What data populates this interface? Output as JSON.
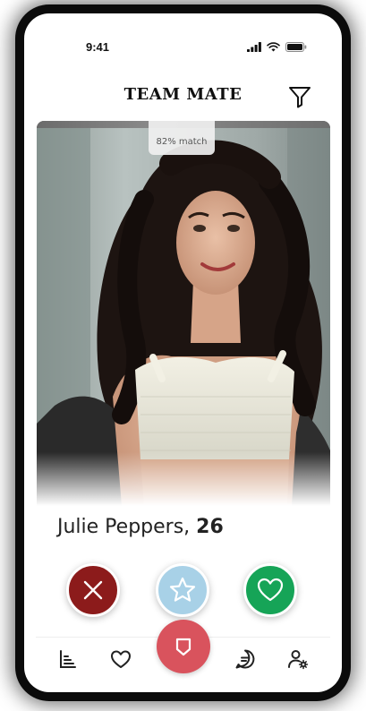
{
  "status_bar": {
    "time": "9:41",
    "icons": [
      "signal-icon",
      "wifi-icon",
      "battery-icon"
    ]
  },
  "header": {
    "title": "TEAM MATE",
    "filter_icon": "filter-icon"
  },
  "profile": {
    "match_label": "82% match",
    "name": "Julie Peppers,",
    "age": "26"
  },
  "actions": [
    {
      "name": "nope",
      "icon": "close-icon",
      "color": "#8c1b1b"
    },
    {
      "name": "super-like",
      "icon": "star-icon",
      "color": "#a8d1e7"
    },
    {
      "name": "like",
      "icon": "heart-icon",
      "color": "#16a457"
    }
  ],
  "tabbar": {
    "tabs": [
      "stats-icon",
      "heart-icon",
      "home-icon",
      "chat-icon",
      "user-settings-icon"
    ],
    "active_color": "#d9535d"
  }
}
